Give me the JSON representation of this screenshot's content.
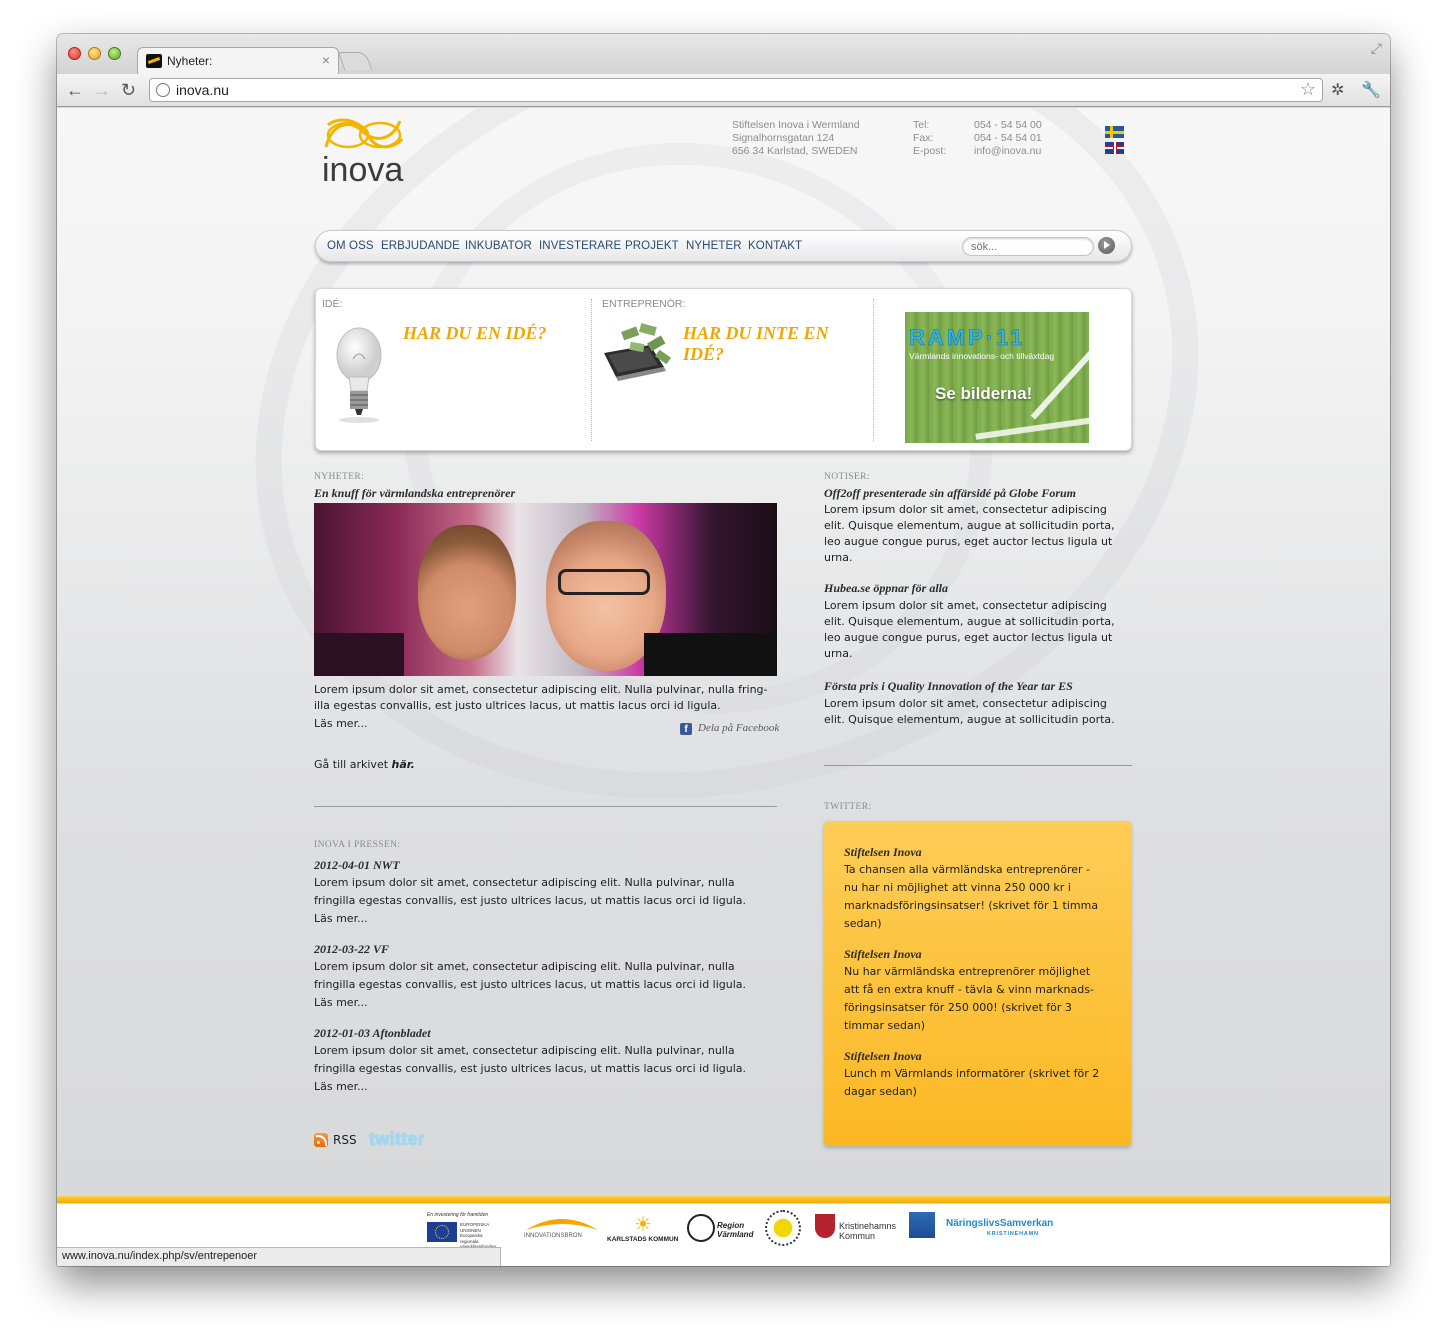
{
  "browser": {
    "tab_title": "Nyheter:",
    "url": "inova.nu",
    "status_url": "www.inova.nu/index.php/sv/entrepenoer"
  },
  "header": {
    "logo_text": "inova",
    "address": [
      "Stiftelsen Inova i Wermland",
      "Signalhornsgatan 124",
      "656 34 Karlstad, SWEDEN"
    ],
    "contact_labels": [
      "Tel:",
      "Fax:",
      "E-post:"
    ],
    "contact_values": [
      "054 - 54 54 00",
      "054 - 54 54 01",
      "info@inova.nu"
    ],
    "languages": [
      "Svenska",
      "English"
    ]
  },
  "nav": {
    "items": [
      "OM OSS",
      "ERBJUDANDE",
      "INKUBATOR",
      "INVESTERARE",
      "PROJEKT",
      "NYHETER",
      "KONTAKT"
    ],
    "search_placeholder": "sök..."
  },
  "promo": {
    "ide_label": "IDÉ:",
    "ide_head": "HAR DU EN IDÉ?",
    "entre_label": "ENTREPRENÖR:",
    "entre_head": "HAR DU INTE EN IDÉ?",
    "ramp_title": "RAMP·11",
    "ramp_sub": "Värmlands innovations- och tillväxtdag",
    "ramp_cta": "Se bilderna!"
  },
  "news": {
    "label": "NYHETER:",
    "title": "En knuff för värmlandska entreprenörer",
    "body": [
      "Lorem ipsum dolor sit amet, consectetur adipiscing elit. Nulla pulvinar, nulla fring-",
      "illa egestas convallis, est justo ultrices lacus, ut mattis lacus orci id ligula."
    ],
    "read_more": "Läs mer...",
    "share": "Dela på Facebook",
    "archive_prefix": "Gå till arkivet ",
    "archive_link": "här."
  },
  "press": {
    "label": "INOVA I PRESSEN:",
    "items": [
      {
        "title": "2012-04-01 NWT",
        "lines": [
          "Lorem ipsum dolor sit amet, consectetur adipiscing elit. Nulla pulvinar, nulla",
          "fringilla egestas convallis, est justo ultrices lacus, ut mattis lacus orci id ligula."
        ],
        "more": "Läs mer..."
      },
      {
        "title": "2012-03-22 VF",
        "lines": [
          "Lorem ipsum dolor sit amet, consectetur adipiscing elit. Nulla pulvinar, nulla",
          "fringilla egestas convallis, est justo ultrices lacus, ut mattis lacus orci id ligula."
        ],
        "more": "Läs mer..."
      },
      {
        "title": "2012-01-03 Aftonbladet",
        "lines": [
          "Lorem ipsum dolor sit amet, consectetur adipiscing elit. Nulla pulvinar, nulla",
          "fringilla egestas convallis, est justo ultrices lacus, ut mattis lacus orci id ligula."
        ],
        "more": "Läs mer..."
      }
    ]
  },
  "notiser": {
    "label": "NOTISER:",
    "items": [
      {
        "title": "Off2off presenterade sin affärsidé på Globe Forum",
        "lines": [
          "Lorem ipsum dolor sit amet, consectetur adipiscing",
          "elit. Quisque elementum, augue at sollicitudin porta,",
          "leo augue congue purus, eget auctor lectus ligula ut",
          "urna."
        ]
      },
      {
        "title": "Hubea.se öppnar för alla",
        "lines": [
          "Lorem ipsum dolor sit amet, consectetur adipiscing",
          "elit. Quisque elementum, augue at sollicitudin porta,",
          "leo augue congue purus, eget auctor lectus ligula ut",
          "urna."
        ]
      },
      {
        "title": "Första pris i Quality Innovation of the Year tar ES",
        "lines": [
          "Lorem ipsum dolor sit amet, consectetur adipiscing",
          "elit. Quisque elementum, augue at sollicitudin porta."
        ]
      }
    ]
  },
  "twitter": {
    "label": "TWITTER:",
    "tweets": [
      {
        "name": "Stiftelsen Inova",
        "lines": [
          "Ta chansen alla värmländska entreprenörer -",
          "nu har ni möjlighet att vinna 250 000 kr i",
          "marknadsföringsinsatser! (skrivet för 1 timma",
          "sedan)"
        ]
      },
      {
        "name": "Stiftelsen Inova",
        "lines": [
          "Nu har värmländska entreprenörer möjlighet",
          "att få en extra knuff - tävla & vinn marknads-",
          "föringsinsatser för 250 000! (skrivet för 3",
          "timmar sedan)"
        ]
      },
      {
        "name": "Stiftelsen Inova",
        "lines": [
          "Lunch m Värmlands informatörer (skrivet för 2",
          "dagar sedan)"
        ]
      }
    ]
  },
  "social": {
    "rss": "RSS",
    "twitter": "twitter"
  },
  "sponsors": {
    "eu_tag": "En investering för framtiden",
    "eu_name": "EUROPEISKA UNIONEN Europeiska regionala utvecklingsfonden",
    "innovationsbron": "INNOVATIONSBRON",
    "karlstad": "KARLSTADS KOMMUN",
    "region": "Region Värmland",
    "kristinehamn": "Kristinehamns Kommun",
    "naringsliv": "NäringslivsSamverkan",
    "naringsliv_sub": "KRISTINEHAMN"
  }
}
